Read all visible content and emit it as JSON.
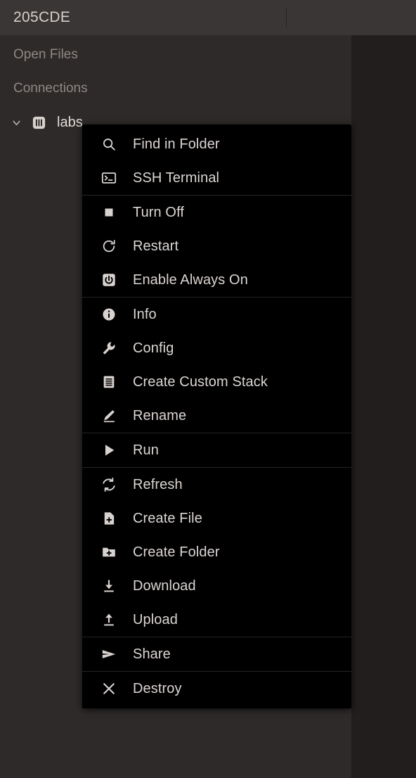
{
  "window": {
    "title": "205CDE"
  },
  "sidebar": {
    "sections": [
      {
        "label": "Open Files",
        "icon": "none"
      },
      {
        "label": "Connections",
        "icon": "none"
      }
    ],
    "tree": [
      {
        "label": "labs",
        "expanded_icon": "chevron-down-icon",
        "type_icon": "stack-icon"
      }
    ]
  },
  "context_menu": {
    "target": "labs",
    "groups": [
      {
        "items": [
          {
            "label": "Find in Folder",
            "icon": "search-icon"
          },
          {
            "label": "SSH Terminal",
            "icon": "terminal-icon"
          }
        ]
      },
      {
        "items": [
          {
            "label": "Turn Off",
            "icon": "stop-square-icon"
          },
          {
            "label": "Restart",
            "icon": "restart-icon"
          },
          {
            "label": "Enable Always On",
            "icon": "power-icon"
          }
        ]
      },
      {
        "items": [
          {
            "label": "Info",
            "icon": "info-icon"
          },
          {
            "label": "Config",
            "icon": "wrench-icon"
          },
          {
            "label": "Create Custom Stack",
            "icon": "list-document-icon"
          },
          {
            "label": "Rename",
            "icon": "pencil-icon"
          }
        ]
      },
      {
        "items": [
          {
            "label": "Run",
            "icon": "play-icon"
          }
        ]
      },
      {
        "items": [
          {
            "label": "Refresh",
            "icon": "refresh-icon"
          },
          {
            "label": "Create File",
            "icon": "file-plus-icon"
          },
          {
            "label": "Create Folder",
            "icon": "folder-plus-icon"
          },
          {
            "label": "Download",
            "icon": "download-icon"
          },
          {
            "label": "Upload",
            "icon": "upload-icon"
          }
        ]
      },
      {
        "items": [
          {
            "label": "Share",
            "icon": "send-icon"
          }
        ]
      },
      {
        "items": [
          {
            "label": "Destroy",
            "icon": "close-x-icon"
          }
        ]
      }
    ]
  },
  "colors": {
    "header_bg": "#3a3635",
    "sidebar_bg": "#2e2a29",
    "main_bg": "#211e1d",
    "menu_bg": "#000000",
    "text_primary": "#dcd6d3",
    "text_muted": "#8e8884"
  }
}
